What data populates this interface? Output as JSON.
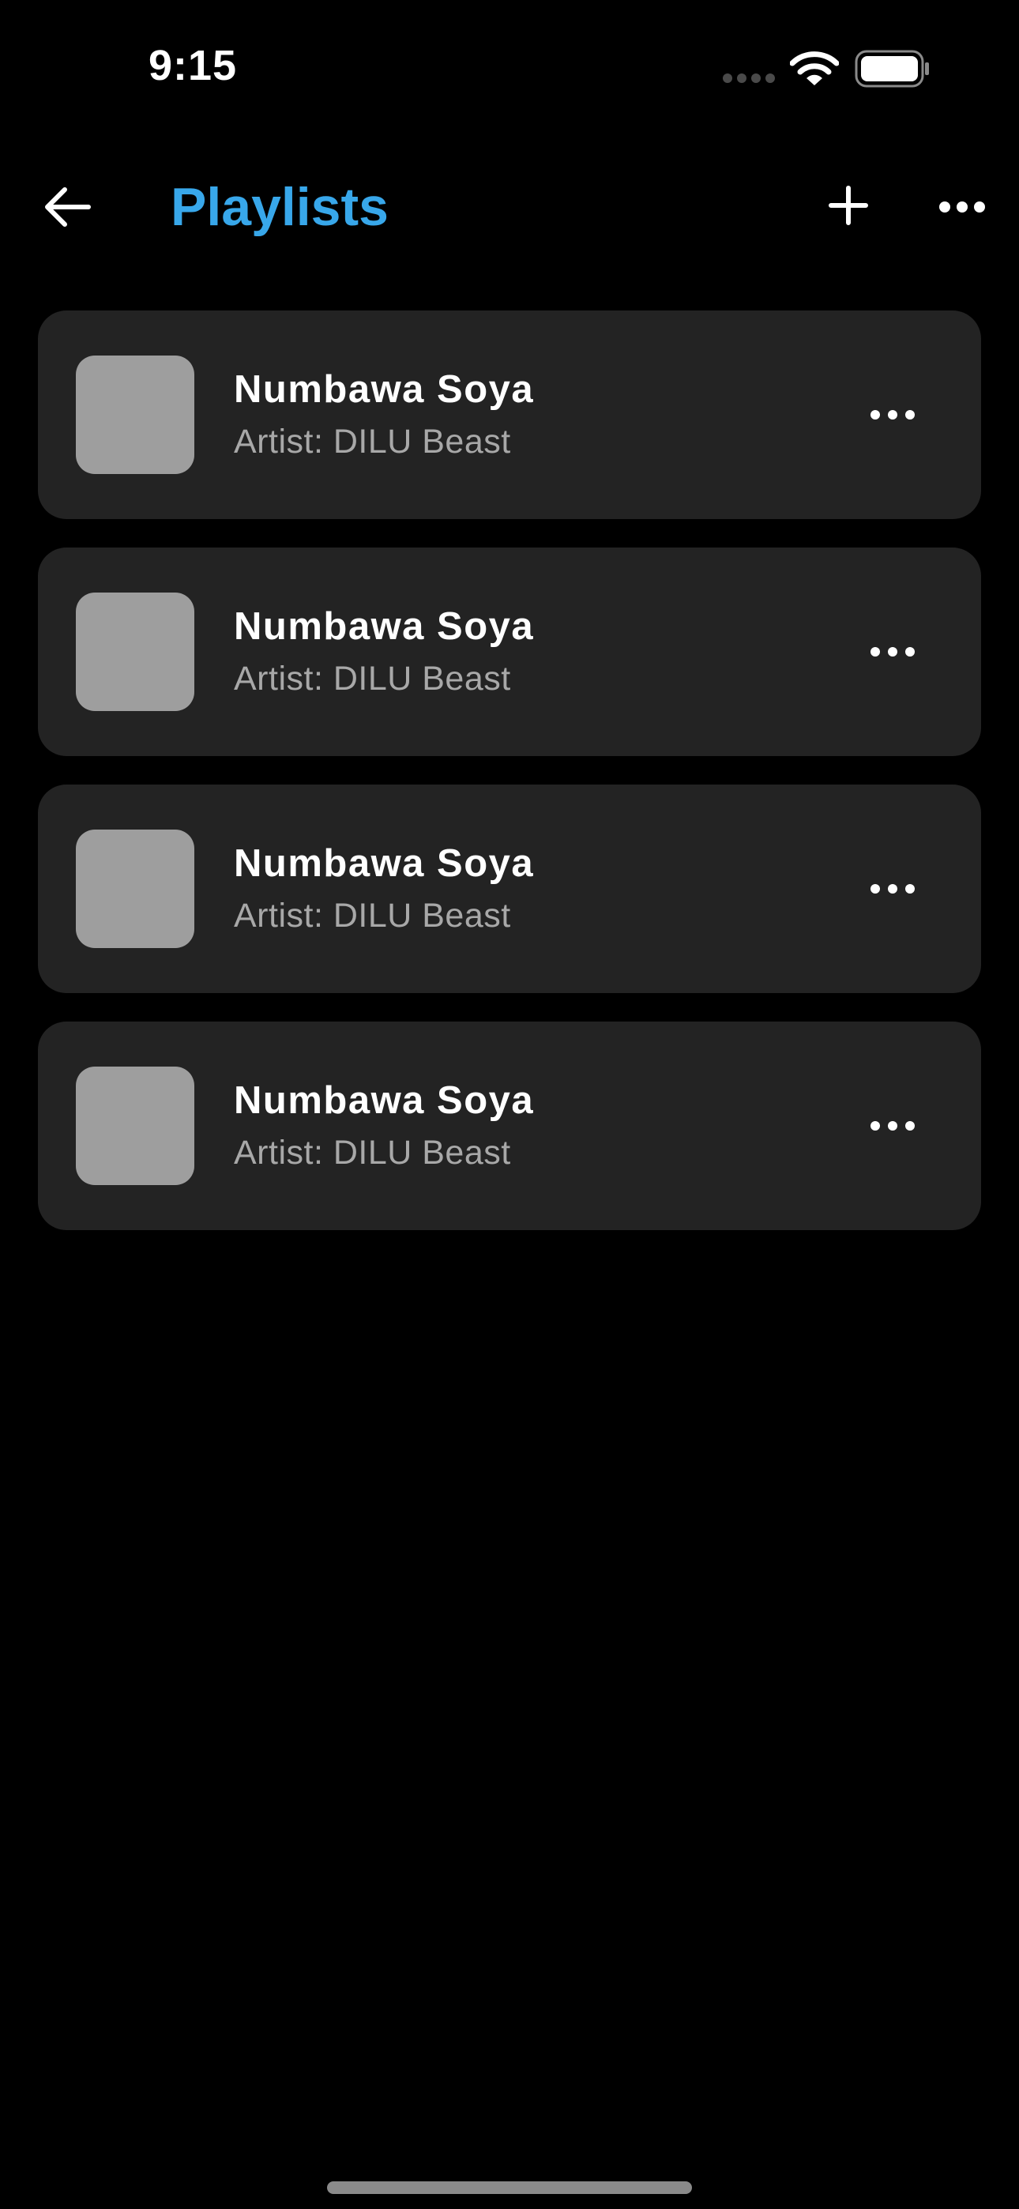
{
  "status_bar": {
    "time": "9:15",
    "icons": [
      "cellular-signal-icon",
      "wifi-icon",
      "battery-icon"
    ]
  },
  "header": {
    "title": "Playlists",
    "back_icon": "arrow-left-icon",
    "add_icon": "plus-icon",
    "more_icon": "ellipsis-icon"
  },
  "playlists": [
    {
      "title": "Numbawa Soya",
      "artist": "Artist: DILU Beast"
    },
    {
      "title": "Numbawa Soya",
      "artist": "Artist: DILU Beast"
    },
    {
      "title": "Numbawa Soya",
      "artist": "Artist: DILU Beast"
    },
    {
      "title": "Numbawa Soya",
      "artist": "Artist: DILU Beast"
    }
  ],
  "colors": {
    "background": "#000000",
    "accent": "#38a7ea",
    "card": "#232323",
    "thumbnail": "#9e9e9e",
    "secondary_text": "#a8a8a8"
  }
}
